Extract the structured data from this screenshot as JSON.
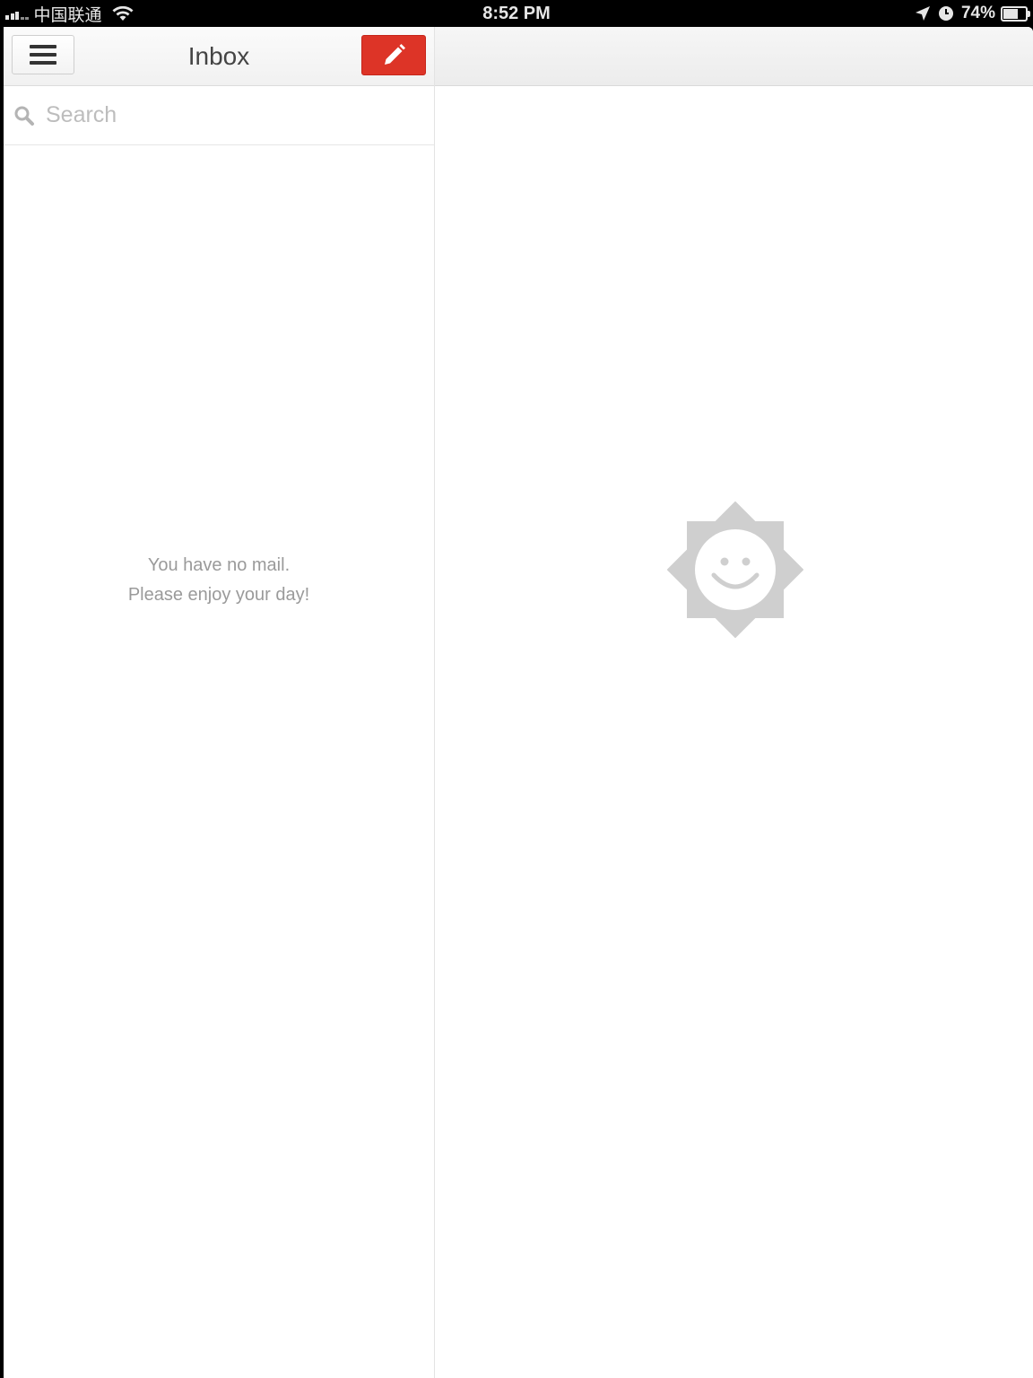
{
  "status_bar": {
    "carrier": "中国联通",
    "time": "8:52 PM",
    "battery_percent": "74%",
    "battery_level": 0.74
  },
  "header": {
    "title": "Inbox",
    "menu_icon": "hamburger-icon",
    "compose_icon": "pencil-icon",
    "compose_color": "#dd3427"
  },
  "search": {
    "placeholder": "Search",
    "value": ""
  },
  "empty_state": {
    "line1": "You have no mail.",
    "line2": "Please enjoy your day!",
    "illustration": "smiling-sun-icon"
  }
}
